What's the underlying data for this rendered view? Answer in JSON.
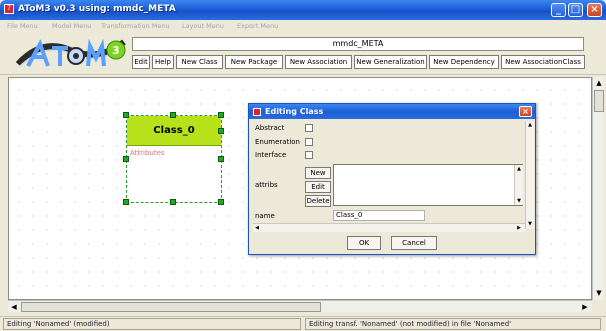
{
  "window": {
    "title": "AToM3 v0.3 using: mmdc_META"
  },
  "menu": [
    "File Menu",
    "Model Menu",
    "Transformation Menu",
    "Layout Menu",
    "Export Menu"
  ],
  "toolbar": {
    "meta_model": "mmdc_META",
    "buttons": [
      "Edit",
      "Help",
      "New Class",
      "New Package",
      "New Association",
      "New Generalization",
      "New Dependency",
      "New AssociationClass"
    ]
  },
  "canvas": {
    "class": {
      "name": "Class_0",
      "attributes_label": "Attributes"
    }
  },
  "dialog": {
    "title": "Editing Class",
    "fields": {
      "abstract": "Abstract",
      "enumeration": "Enumeration",
      "interface": "Interface",
      "attribs": "attribs",
      "name": "name"
    },
    "attrib_buttons": {
      "new": "New",
      "edit": "Edit",
      "delete": "Delete"
    },
    "name_value": "Class_0",
    "ok": "OK",
    "cancel": "Cancel"
  },
  "status": {
    "left": "Editing 'Nonamed' (modified)",
    "right": "Editing transf. 'Nonamed' (not modified) in file 'Nonamed'"
  },
  "colors": {
    "titlebar": "#1d5fd8",
    "class_header": "#b6e11b",
    "handle": "#23a823"
  }
}
